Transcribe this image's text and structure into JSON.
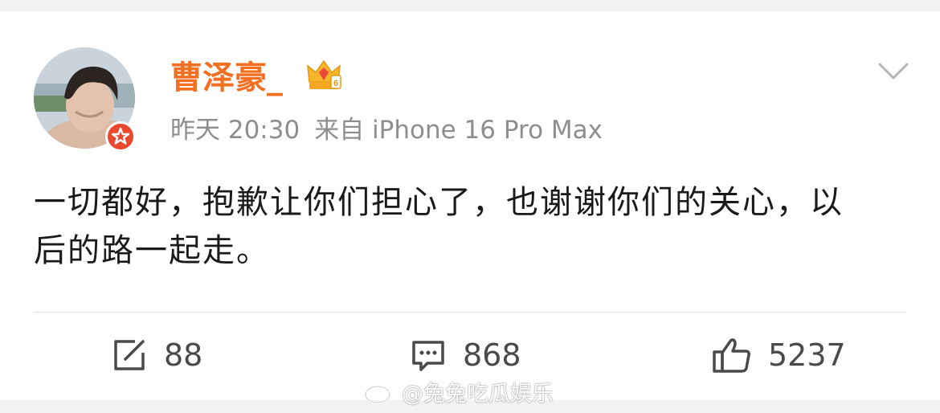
{
  "post": {
    "username": "曹泽豪_",
    "timestamp": "昨天 20:30",
    "source": "来自 iPhone 16 Pro Max",
    "text": "一切都好，抱歉让你们担心了，也谢谢你们的关心，以后的路一起走。"
  },
  "actions": {
    "repost_count": "88",
    "comment_count": "868",
    "like_count": "5237"
  },
  "watermark": {
    "text": "@兔兔吃瓜娱乐"
  },
  "icons": {
    "avatar": "avatar-photo",
    "verified": "verified-badge-icon",
    "membership": "crown-icon",
    "more": "chevron-down-icon",
    "repost": "repost-icon",
    "comment": "comment-icon",
    "like": "thumbs-up-icon",
    "watermark_logo": "weibo-logo-icon"
  },
  "colors": {
    "username": "#f36f21",
    "meta": "#8e8e8e",
    "text": "#1a1a1a",
    "verified": "#e94a2f",
    "background": "#f2f2f2"
  }
}
